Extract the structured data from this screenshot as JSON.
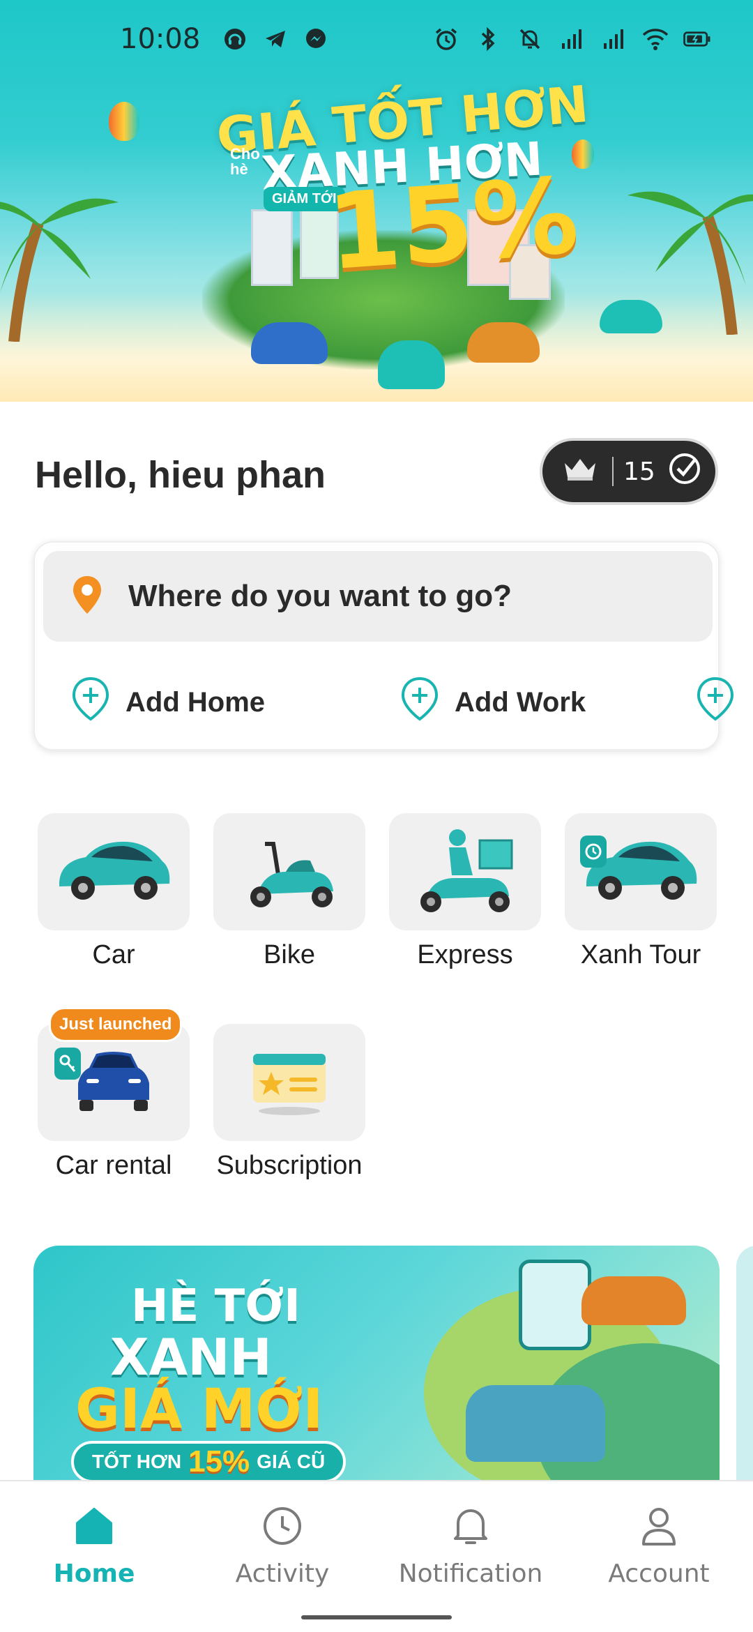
{
  "status_bar": {
    "time": "10:08",
    "left_icons": [
      "headset-icon",
      "telegram-icon",
      "messenger-icon"
    ],
    "right_icons": [
      "alarm-icon",
      "bluetooth-icon",
      "mute-bell-icon",
      "signal-icon",
      "signal-icon",
      "wifi-icon",
      "battery-charging-icon"
    ]
  },
  "hero_banner": {
    "line1": "GIÁ TỐT HƠN",
    "cho_he": "Cho hè",
    "line2": "XANH HƠN",
    "badge": "GIẢM TỚI",
    "percent": "15%"
  },
  "greeting": "Hello, hieu phan",
  "rank": {
    "icon": "crown-icon",
    "count": "15",
    "check_icon": "check-circle-icon"
  },
  "destination": {
    "placeholder": "Where do you want to go?",
    "quick_links": [
      {
        "label": "Add Home"
      },
      {
        "label": "Add Work"
      }
    ]
  },
  "services": [
    {
      "label": "Car"
    },
    {
      "label": "Bike"
    },
    {
      "label": "Express"
    },
    {
      "label": "Xanh Tour"
    },
    {
      "label": "Car rental",
      "badge": "Just launched"
    },
    {
      "label": "Subscription"
    }
  ],
  "promo_banner": {
    "line1": "HÈ TỚI",
    "line2": "XANH",
    "line3": "GIÁ MỚI",
    "pill_prefix": "TỐT HƠN",
    "pill_percent": "15%",
    "pill_suffix": "GIÁ CŨ"
  },
  "bottom_nav": [
    {
      "label": "Home",
      "icon": "home-icon",
      "active": true
    },
    {
      "label": "Activity",
      "icon": "clock-icon",
      "active": false
    },
    {
      "label": "Notification",
      "icon": "bell-icon",
      "active": false
    },
    {
      "label": "Account",
      "icon": "person-icon",
      "active": false
    }
  ],
  "colors": {
    "brand_teal": "#15b3b3",
    "accent_orange": "#f08a1c",
    "pill_dark": "#2b2b2b"
  }
}
